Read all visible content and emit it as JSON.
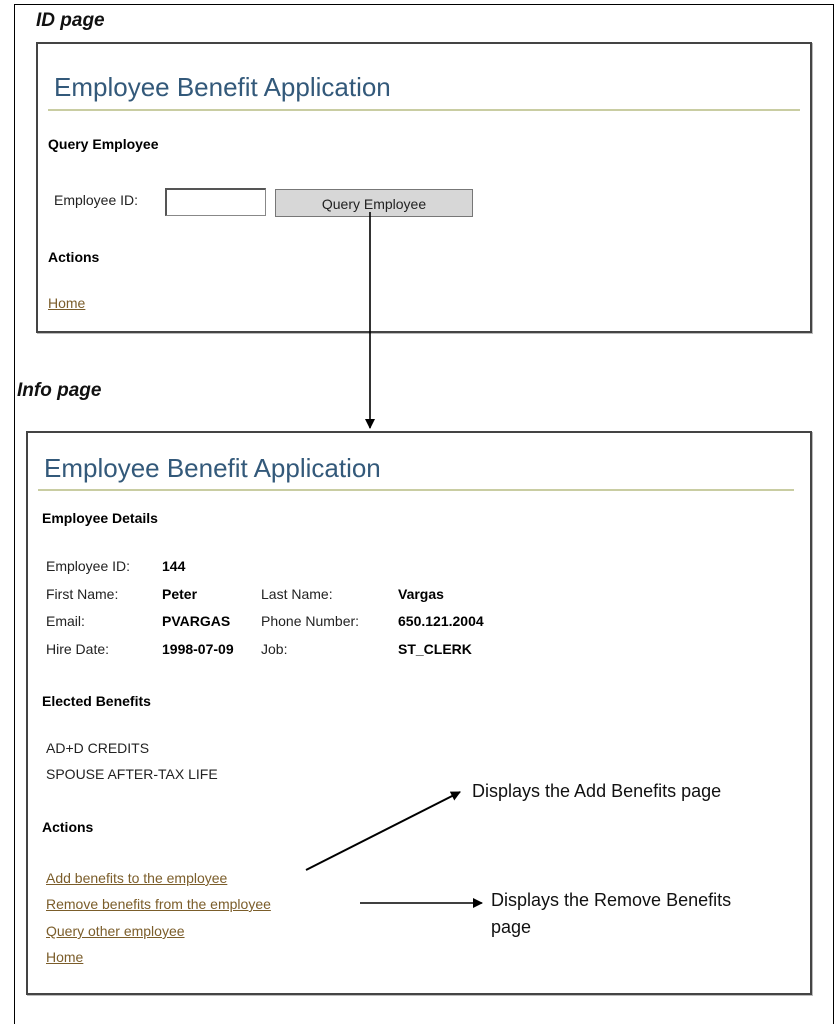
{
  "labels": {
    "id_page": "ID page",
    "info_page": "Info page"
  },
  "id_page": {
    "app_title": "Employee Benefit Application",
    "query_heading": "Query Employee",
    "employee_id_label": "Employee ID:",
    "employee_id_value": "",
    "query_button": "Query Employee",
    "actions_heading": "Actions",
    "home_link": "Home"
  },
  "info_page": {
    "app_title": "Employee Benefit Application",
    "details_heading": "Employee Details",
    "details": {
      "employee_id_label": "Employee ID:",
      "employee_id": "144",
      "first_name_label": "First Name:",
      "first_name": "Peter",
      "last_name_label": "Last Name:",
      "last_name": "Vargas",
      "email_label": "Email:",
      "email": "PVARGAS",
      "phone_label": "Phone Number:",
      "phone": "650.121.2004",
      "hire_date_label": "Hire Date:",
      "hire_date": "1998-07-09",
      "job_label": "Job:",
      "job": "ST_CLERK"
    },
    "benefits_heading": "Elected Benefits",
    "benefits": [
      "AD+D CREDITS",
      "SPOUSE AFTER-TAX LIFE"
    ],
    "actions_heading": "Actions",
    "actions": [
      "Add benefits to the employee",
      "Remove benefits from the employee",
      "Query other employee",
      "Home"
    ]
  },
  "callouts": {
    "add": "Displays the Add Benefits page",
    "remove_line1": "Displays the Remove Benefits",
    "remove_line2": "page"
  }
}
